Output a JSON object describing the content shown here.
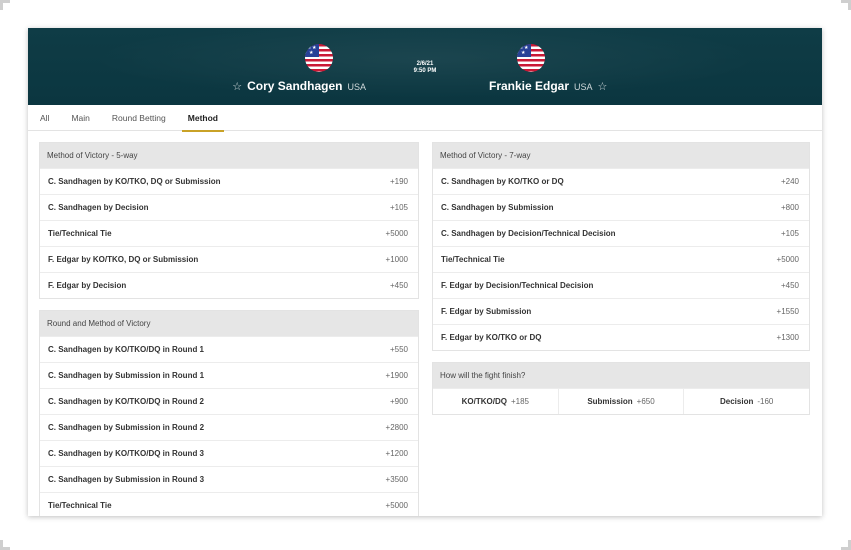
{
  "event": {
    "date": "2/6/21",
    "time": "9:50 PM",
    "fighter_left": {
      "name": "Cory Sandhagen",
      "country": "USA"
    },
    "fighter_right": {
      "name": "Frankie Edgar",
      "country": "USA"
    },
    "star_glyph": "☆"
  },
  "tabs": [
    {
      "label": "All"
    },
    {
      "label": "Main"
    },
    {
      "label": "Round Betting"
    },
    {
      "label": "Method",
      "active": true
    }
  ],
  "markets": {
    "five_way": {
      "title": "Method of Victory - 5-way",
      "rows": [
        {
          "selection": "C. Sandhagen by KO/TKO, DQ or Submission",
          "odds": "+190"
        },
        {
          "selection": "C. Sandhagen by Decision",
          "odds": "+105"
        },
        {
          "selection": "Tie/Technical Tie",
          "odds": "+5000"
        },
        {
          "selection": "F. Edgar by KO/TKO, DQ or Submission",
          "odds": "+1000"
        },
        {
          "selection": "F. Edgar by Decision",
          "odds": "+450"
        }
      ]
    },
    "round_method": {
      "title": "Round and Method of Victory",
      "rows": [
        {
          "selection": "C. Sandhagen by KO/TKO/DQ in Round 1",
          "odds": "+550"
        },
        {
          "selection": "C. Sandhagen by Submission in Round 1",
          "odds": "+1900"
        },
        {
          "selection": "C. Sandhagen by KO/TKO/DQ in Round 2",
          "odds": "+900"
        },
        {
          "selection": "C. Sandhagen by Submission in Round 2",
          "odds": "+2800"
        },
        {
          "selection": "C. Sandhagen by KO/TKO/DQ in Round 3",
          "odds": "+1200"
        },
        {
          "selection": "C. Sandhagen by Submission in Round 3",
          "odds": "+3500"
        },
        {
          "selection": "Tie/Technical Tie",
          "odds": "+5000"
        }
      ]
    },
    "seven_way": {
      "title": "Method of Victory - 7-way",
      "rows": [
        {
          "selection": "C. Sandhagen by KO/TKO or DQ",
          "odds": "+240"
        },
        {
          "selection": "C. Sandhagen by Submission",
          "odds": "+800"
        },
        {
          "selection": "C. Sandhagen by Decision/Technical Decision",
          "odds": "+105"
        },
        {
          "selection": "Tie/Technical Tie",
          "odds": "+5000"
        },
        {
          "selection": "F. Edgar by Decision/Technical Decision",
          "odds": "+450"
        },
        {
          "selection": "F. Edgar by Submission",
          "odds": "+1550"
        },
        {
          "selection": "F. Edgar by KO/TKO or DQ",
          "odds": "+1300"
        }
      ]
    },
    "finish": {
      "title": "How will the fight finish?",
      "options": [
        {
          "selection": "KO/TKO/DQ",
          "odds": "+185"
        },
        {
          "selection": "Submission",
          "odds": "+650"
        },
        {
          "selection": "Decision",
          "odds": "-160"
        }
      ]
    }
  },
  "colors": {
    "header_bg": "#0f3c46",
    "tab_accent": "#c9a227",
    "market_title_bg": "#e6e6e6"
  }
}
